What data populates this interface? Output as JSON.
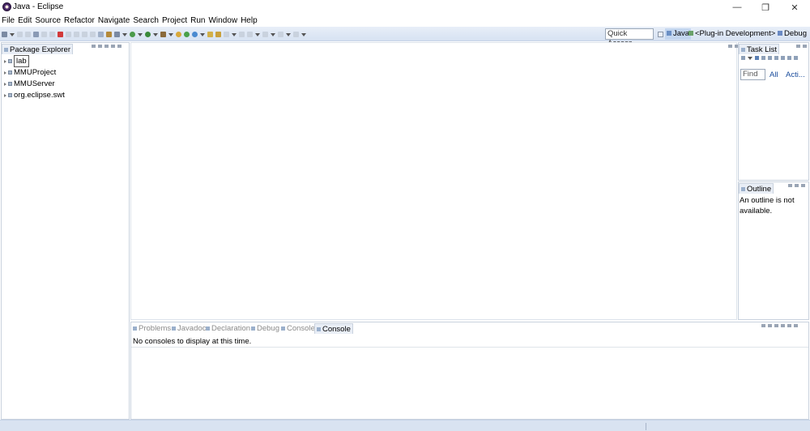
{
  "window": {
    "title": "Java - Eclipse",
    "controls": {
      "minimize": "—",
      "maximize": "❐",
      "close": "✕"
    }
  },
  "menu": [
    "File",
    "Edit",
    "Source",
    "Refactor",
    "Navigate",
    "Search",
    "Project",
    "Run",
    "Window",
    "Help"
  ],
  "toolbar": {
    "quick_access": "Quick Access",
    "perspectives": [
      {
        "label": "Java",
        "active": true
      },
      {
        "label": "<Plug-in Development>",
        "active": false
      },
      {
        "label": "Debug",
        "active": false
      }
    ]
  },
  "package_explorer": {
    "tab_label": "Package Explorer",
    "items": [
      {
        "label": "lab",
        "selected": true
      },
      {
        "label": "MMUProject",
        "selected": false
      },
      {
        "label": "MMUServer",
        "selected": false
      },
      {
        "label": "org.eclipse.swt",
        "selected": false
      }
    ]
  },
  "task_list": {
    "tab_label": "Task List",
    "find_placeholder": "Find",
    "links": [
      "All",
      "Acti..."
    ]
  },
  "outline": {
    "tab_label": "Outline",
    "message": "An outline is not available."
  },
  "bottom_panel": {
    "tabs": [
      {
        "label": "Problems",
        "active": false
      },
      {
        "label": "Javadoc",
        "active": false
      },
      {
        "label": "Declaration",
        "active": false
      },
      {
        "label": "Debug",
        "active": false
      },
      {
        "label": "Console",
        "active": false
      },
      {
        "label": "Console",
        "active": true
      }
    ],
    "message": "No consoles to display at this time."
  }
}
